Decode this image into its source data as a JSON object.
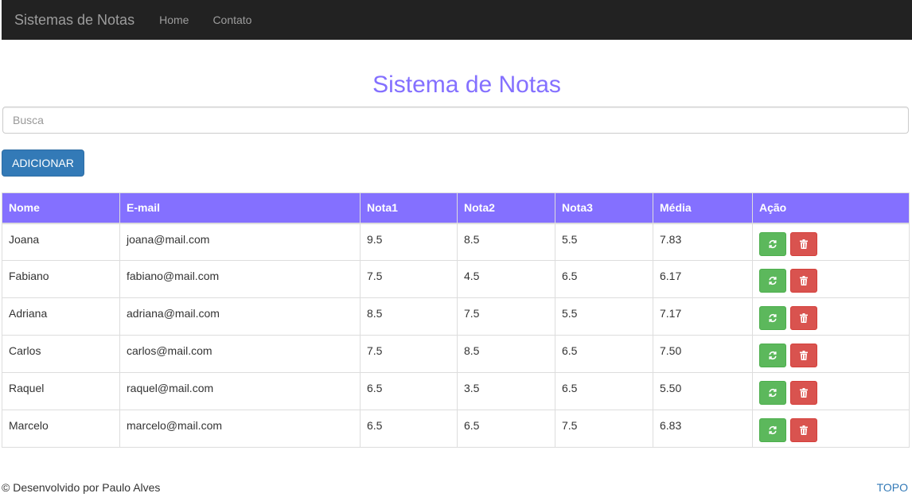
{
  "nav": {
    "brand": "Sistemas de Notas",
    "links": [
      "Home",
      "Contato"
    ]
  },
  "page": {
    "title": "Sistema de Notas"
  },
  "search": {
    "placeholder": "Busca"
  },
  "add_button": {
    "label": "ADICIONAR"
  },
  "table": {
    "headers": [
      "Nome",
      "E-mail",
      "Nota1",
      "Nota2",
      "Nota3",
      "Média",
      "Ação"
    ],
    "rows": [
      [
        "Joana",
        "joana@mail.com",
        "9.5",
        "8.5",
        "5.5",
        "7.83"
      ],
      [
        "Fabiano",
        "fabiano@mail.com",
        "7.5",
        "4.5",
        "6.5",
        "6.17"
      ],
      [
        "Adriana",
        "adriana@mail.com",
        "8.5",
        "7.5",
        "5.5",
        "7.17"
      ],
      [
        "Carlos",
        "carlos@mail.com",
        "7.5",
        "8.5",
        "6.5",
        "7.50"
      ],
      [
        "Raquel",
        "raquel@mail.com",
        "6.5",
        "3.5",
        "6.5",
        "5.50"
      ],
      [
        "Marcelo",
        "marcelo@mail.com",
        "6.5",
        "6.5",
        "7.5",
        "6.83"
      ]
    ],
    "actions": {
      "edit_icon": "refresh-icon",
      "delete_icon": "trash-icon"
    }
  },
  "footer": {
    "text": "© Desenvolvido por Paulo Alves",
    "top_link": "TOPO"
  },
  "colors": {
    "accent": "#8470ff",
    "primary": "#337ab7",
    "success": "#5cb85c",
    "danger": "#d9534f",
    "navbar": "#222222"
  }
}
